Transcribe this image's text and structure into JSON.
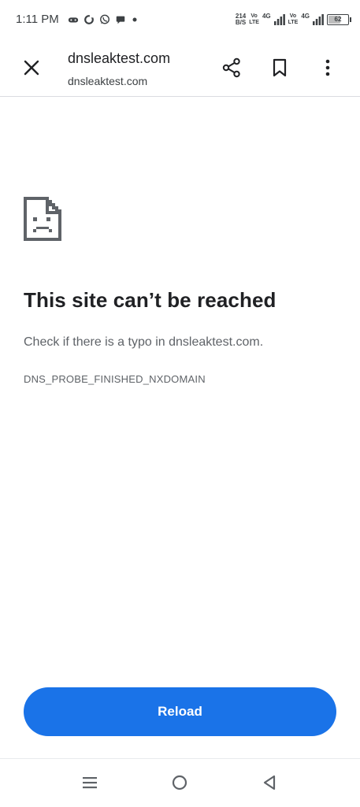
{
  "status_bar": {
    "time": "1:11 PM",
    "net_speed_value": "214",
    "net_speed_unit": "B/S",
    "volte_1_top": "Vo",
    "volte_1_bottom": "LTE",
    "signal_1_label": "4G",
    "volte_2_top": "Vo",
    "volte_2_bottom": "LTE",
    "signal_2_label": "4G",
    "battery_level": "62",
    "icons": [
      "game-controller-icon",
      "sync-icon",
      "whatsapp-icon",
      "chat-bubble-icon",
      "dot-icon",
      "signal-icon",
      "battery-icon"
    ]
  },
  "toolbar": {
    "title": "dnsleaktest.com",
    "url": "dnsleaktest.com",
    "icons": [
      "close-icon",
      "share-icon",
      "bookmark-icon",
      "more-vert-icon"
    ]
  },
  "error": {
    "icon": "sad-page-icon",
    "title": "This site can’t be reached",
    "message": "Check if there is a typo in dnsleaktest.com.",
    "code": "DNS_PROBE_FINISHED_NXDOMAIN"
  },
  "actions": {
    "reload_label": "Reload",
    "accent_color": "#1a73e8"
  },
  "nav_bar": {
    "icons": [
      "recents-menu-icon",
      "home-circle-icon",
      "back-triangle-icon"
    ]
  }
}
